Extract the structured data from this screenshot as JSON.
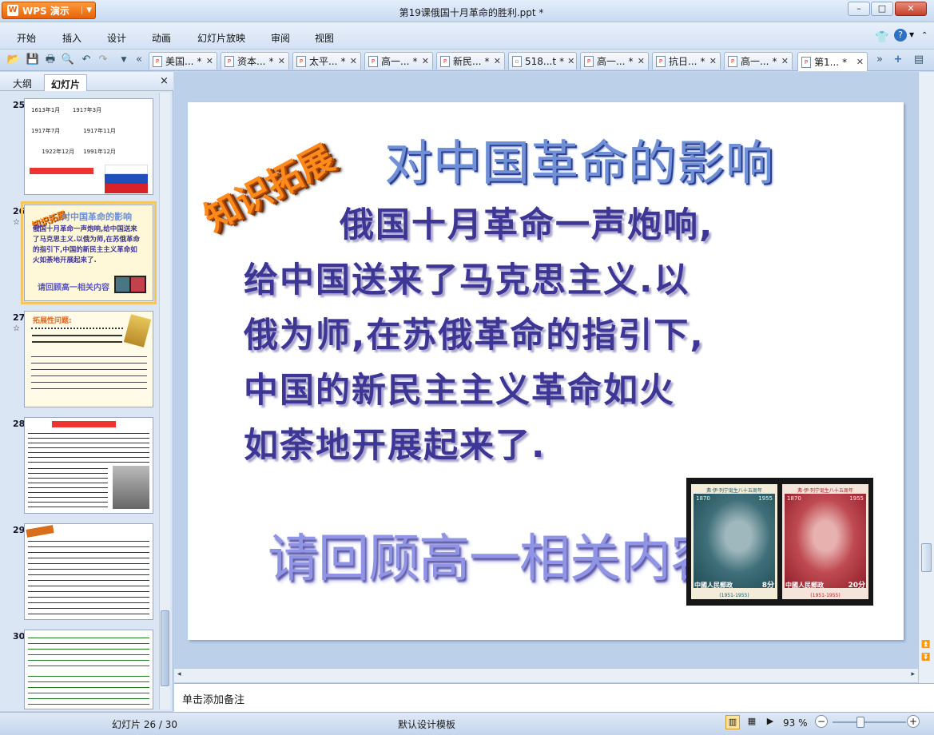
{
  "app": {
    "name": "WPS 演示",
    "doc_title": "第19课俄国十月革命的胜利.ppt *"
  },
  "window_buttons": {
    "minimize": "–",
    "restore": "□",
    "close": "✕"
  },
  "menu": [
    "开始",
    "插入",
    "设计",
    "动画",
    "幻灯片放映",
    "审阅",
    "视图"
  ],
  "tabs": [
    {
      "label": "美国...",
      "mod": "*"
    },
    {
      "label": "资本...",
      "mod": "*"
    },
    {
      "label": "太平...",
      "mod": "*"
    },
    {
      "label": "高一...",
      "mod": "*"
    },
    {
      "label": "新民...",
      "mod": "*"
    },
    {
      "label": "518...t",
      "mod": "*"
    },
    {
      "label": "高一...",
      "mod": "*"
    },
    {
      "label": "抗日...",
      "mod": "*"
    },
    {
      "label": "高一...",
      "mod": "*"
    },
    {
      "label": "第1...",
      "mod": "*"
    }
  ],
  "left_panel": {
    "tab_outline": "大纲",
    "tab_slides": "幻灯片",
    "close": "×"
  },
  "thumbnails": [
    {
      "num": "25"
    },
    {
      "num": "26"
    },
    {
      "num": "27"
    },
    {
      "num": "28"
    },
    {
      "num": "29"
    },
    {
      "num": "30"
    }
  ],
  "thumb26": {
    "title": "对中国革命的影响",
    "body": "俄国十月革命一声炮响,给中国送来了马克思主义.以俄为师,在苏俄革命的指引下,中国的新民主主义革命如火如荼地开展起来了.",
    "sub": "请回顾高一相关内容",
    "wordart": "知识拓展"
  },
  "thumb27": {
    "title": "拓展性问题:"
  },
  "slide": {
    "wordart": "知识拓展",
    "title": "对中国革命的影响",
    "body_lines": [
      "俄国十月革命一声炮响,",
      "给中国送来了马克思主义.以",
      "俄为师,在苏俄革命的指引下,",
      "中国的新民主主义革命如火",
      "如荼地开展起来了."
    ],
    "subtitle": "请回顾高一相关内容",
    "stamp1": {
      "header": "弗·伊·列宁诞生八十五周年",
      "year_left": "1870",
      "year_right": "1955",
      "country": "中國人民郵政",
      "value": "8分",
      "code": "(1951-1955)",
      "color": "#1f5e6b"
    },
    "stamp2": {
      "header": "弗·伊·列宁诞生八十五周年",
      "year_left": "1870",
      "year_right": "1955",
      "country": "中國人民郵政",
      "value": "20分",
      "code": "(1951-1955)",
      "color": "#b8202a"
    }
  },
  "notes_placeholder": "单击添加备注",
  "status": {
    "slide_counter": "幻灯片 26 / 30",
    "template": "默认设计模板",
    "zoom": "93 %"
  }
}
